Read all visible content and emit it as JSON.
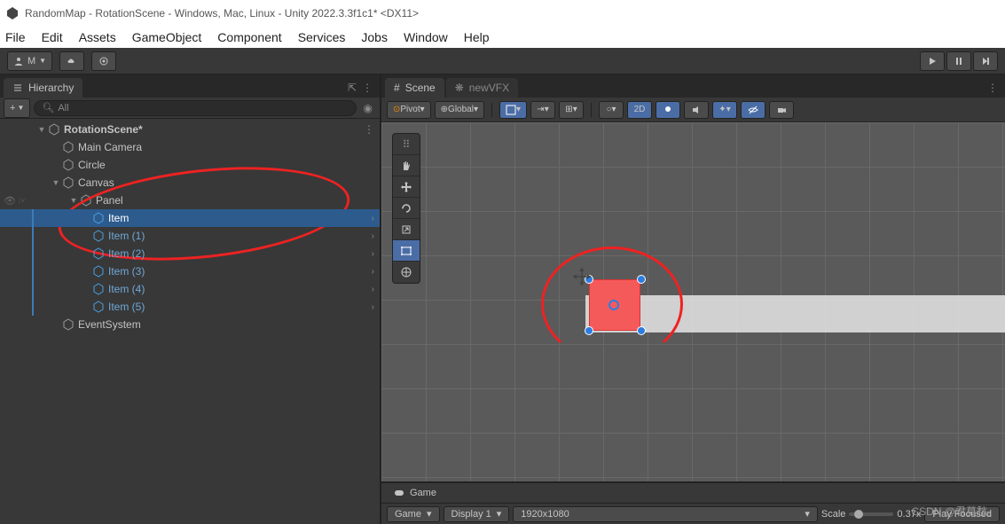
{
  "window": {
    "title": "RandomMap - RotationScene - Windows, Mac, Linux - Unity 2022.3.3f1c1* <DX11>"
  },
  "menu": {
    "items": [
      "File",
      "Edit",
      "Assets",
      "GameObject",
      "Component",
      "Services",
      "Jobs",
      "Window",
      "Help"
    ]
  },
  "account": {
    "label": "M"
  },
  "hierarchy": {
    "title": "Hierarchy",
    "search_placeholder": "All",
    "add_label": "+",
    "scene": "RotationScene*",
    "items": [
      {
        "name": "Main Camera",
        "depth": 1
      },
      {
        "name": "Circle",
        "depth": 1
      },
      {
        "name": "Canvas",
        "depth": 1,
        "expanded": true
      },
      {
        "name": "Panel",
        "depth": 2,
        "expanded": true
      },
      {
        "name": "Item",
        "depth": 3,
        "selected": true,
        "chevron": true
      },
      {
        "name": "Item (1)",
        "depth": 3,
        "chevron": true,
        "dim": true
      },
      {
        "name": "Item (2)",
        "depth": 3,
        "chevron": true,
        "dim": true
      },
      {
        "name": "Item (3)",
        "depth": 3,
        "chevron": true,
        "dim": true
      },
      {
        "name": "Item (4)",
        "depth": 3,
        "chevron": true,
        "dim": true
      },
      {
        "name": "Item (5)",
        "depth": 3,
        "chevron": true,
        "dim": true
      },
      {
        "name": "EventSystem",
        "depth": 1
      }
    ]
  },
  "scene": {
    "tabs": [
      "Scene",
      "newVFX"
    ],
    "pivot": "Pivot",
    "space": "Global",
    "mode2d": "2D"
  },
  "game": {
    "title": "Game",
    "view": "Game",
    "display": "Display 1",
    "resolution": "1920x1080",
    "scale_label": "Scale",
    "scale_value": "0.37x",
    "play_mode": "Play Focused"
  },
  "watermark": "CSDN @君莫愁。"
}
